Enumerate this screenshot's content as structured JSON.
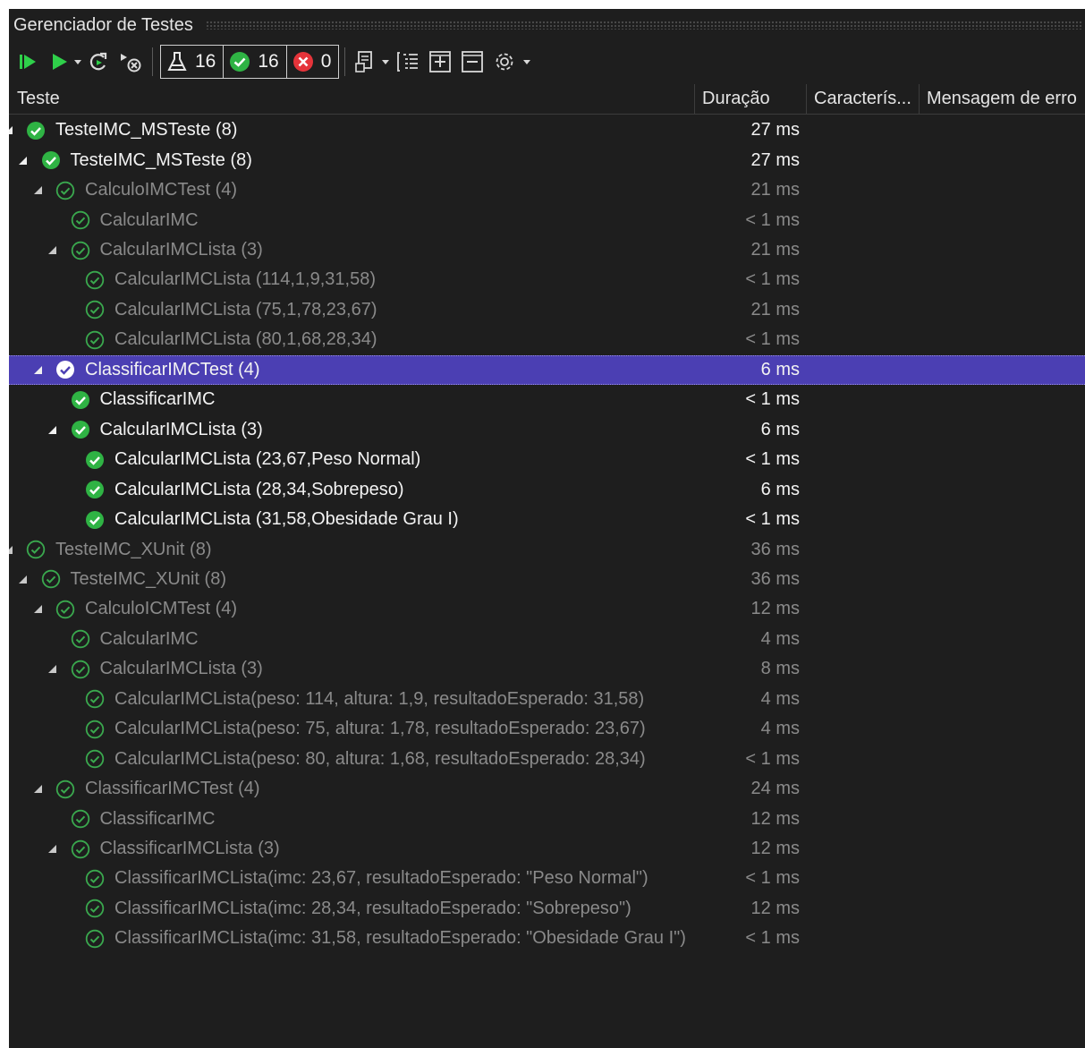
{
  "window": {
    "title": "Gerenciador de Testes"
  },
  "toolbar": {
    "run_all_icon": "run-all-icon",
    "run_icon": "play-icon",
    "counters": {
      "total": "16",
      "passed": "16",
      "failed": "0"
    }
  },
  "columns": {
    "test": "Teste",
    "duration": "Duração",
    "traits": "Caracterís...",
    "error": "Mensagem de erro"
  },
  "colors": {
    "passed": "#2fb344",
    "selected": "#4b3fb3"
  },
  "rows": [
    {
      "level": 0,
      "expanded": true,
      "label": "TesteIMC_MSTeste (8)",
      "duration": "27 ms",
      "state": "bright",
      "icon": "solid"
    },
    {
      "level": 1,
      "expanded": true,
      "label": "TesteIMC_MSTeste (8)",
      "duration": "27 ms",
      "state": "bright",
      "icon": "solid"
    },
    {
      "level": 2,
      "expanded": true,
      "label": "CalculoIMCTest (4)",
      "duration": "21 ms",
      "state": "dim",
      "icon": "outline"
    },
    {
      "level": 3,
      "expanded": null,
      "label": "CalcularIMC",
      "duration": "< 1 ms",
      "state": "dim",
      "icon": "outline"
    },
    {
      "level": 3,
      "expanded": true,
      "label": "CalcularIMCLista (3)",
      "duration": "21 ms",
      "state": "dim",
      "icon": "outline"
    },
    {
      "level": 4,
      "expanded": null,
      "label": "CalcularIMCLista (114,1,9,31,58)",
      "duration": "< 1 ms",
      "state": "dim",
      "icon": "outline"
    },
    {
      "level": 4,
      "expanded": null,
      "label": "CalcularIMCLista (75,1,78,23,67)",
      "duration": "21 ms",
      "state": "dim",
      "icon": "outline"
    },
    {
      "level": 4,
      "expanded": null,
      "label": "CalcularIMCLista (80,1,68,28,34)",
      "duration": "< 1 ms",
      "state": "dim",
      "icon": "outline"
    },
    {
      "level": 2,
      "expanded": true,
      "label": "ClassificarIMCTest (4)",
      "duration": "6 ms",
      "state": "selected",
      "icon": "white"
    },
    {
      "level": 3,
      "expanded": null,
      "label": "ClassificarIMC",
      "duration": "< 1 ms",
      "state": "bright",
      "icon": "solid"
    },
    {
      "level": 3,
      "expanded": true,
      "label": "CalcularIMCLista (3)",
      "duration": "6 ms",
      "state": "bright",
      "icon": "solid"
    },
    {
      "level": 4,
      "expanded": null,
      "label": "CalcularIMCLista (23,67,Peso Normal)",
      "duration": "< 1 ms",
      "state": "bright",
      "icon": "solid"
    },
    {
      "level": 4,
      "expanded": null,
      "label": "CalcularIMCLista (28,34,Sobrepeso)",
      "duration": "6 ms",
      "state": "bright",
      "icon": "solid"
    },
    {
      "level": 4,
      "expanded": null,
      "label": "CalcularIMCLista (31,58,Obesidade Grau I)",
      "duration": "< 1 ms",
      "state": "bright",
      "icon": "solid"
    },
    {
      "level": 0,
      "expanded": true,
      "label": "TesteIMC_XUnit (8)",
      "duration": "36 ms",
      "state": "dim",
      "icon": "outline"
    },
    {
      "level": 1,
      "expanded": true,
      "label": "TesteIMC_XUnit (8)",
      "duration": "36 ms",
      "state": "dim",
      "icon": "outline"
    },
    {
      "level": 2,
      "expanded": true,
      "label": "CalculoICMTest (4)",
      "duration": "12 ms",
      "state": "dim",
      "icon": "outline"
    },
    {
      "level": 3,
      "expanded": null,
      "label": "CalcularIMC",
      "duration": "4 ms",
      "state": "dim",
      "icon": "outline"
    },
    {
      "level": 3,
      "expanded": true,
      "label": "CalcularIMCLista (3)",
      "duration": "8 ms",
      "state": "dim",
      "icon": "outline"
    },
    {
      "level": 4,
      "expanded": null,
      "label": "CalcularIMCLista(peso: 114, altura: 1,9, resultadoEsperado: 31,58)",
      "duration": "4 ms",
      "state": "dim",
      "icon": "outline"
    },
    {
      "level": 4,
      "expanded": null,
      "label": "CalcularIMCLista(peso: 75, altura: 1,78, resultadoEsperado: 23,67)",
      "duration": "4 ms",
      "state": "dim",
      "icon": "outline"
    },
    {
      "level": 4,
      "expanded": null,
      "label": "CalcularIMCLista(peso: 80, altura: 1,68, resultadoEsperado: 28,34)",
      "duration": "< 1 ms",
      "state": "dim",
      "icon": "outline"
    },
    {
      "level": 2,
      "expanded": true,
      "label": "ClassificarIMCTest (4)",
      "duration": "24 ms",
      "state": "dim",
      "icon": "outline"
    },
    {
      "level": 3,
      "expanded": null,
      "label": "ClassificarIMC",
      "duration": "12 ms",
      "state": "dim",
      "icon": "outline"
    },
    {
      "level": 3,
      "expanded": true,
      "label": "ClassificarIMCLista (3)",
      "duration": "12 ms",
      "state": "dim",
      "icon": "outline"
    },
    {
      "level": 4,
      "expanded": null,
      "label": "ClassificarIMCLista(imc: 23,67, resultadoEsperado: \"Peso Normal\")",
      "duration": "< 1 ms",
      "state": "dim",
      "icon": "outline"
    },
    {
      "level": 4,
      "expanded": null,
      "label": "ClassificarIMCLista(imc: 28,34, resultadoEsperado: \"Sobrepeso\")",
      "duration": "12 ms",
      "state": "dim",
      "icon": "outline"
    },
    {
      "level": 4,
      "expanded": null,
      "label": "ClassificarIMCLista(imc: 31,58, resultadoEsperado: \"Obesidade Grau I\")",
      "duration": "< 1 ms",
      "state": "dim",
      "icon": "outline"
    }
  ]
}
